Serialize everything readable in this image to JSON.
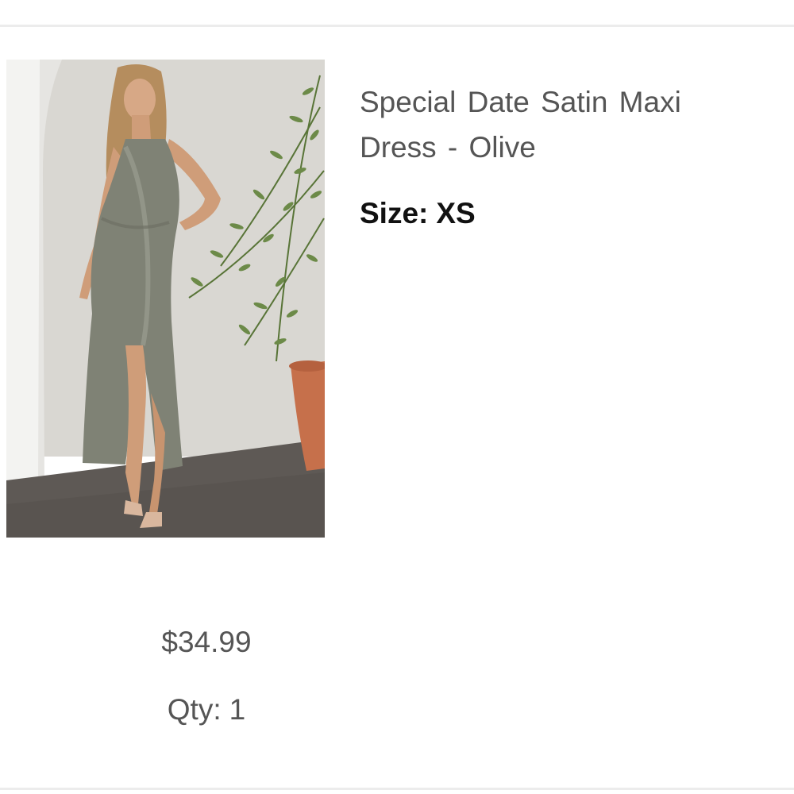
{
  "product": {
    "image_alt": "Model wearing olive satin maxi dress beside potted olive tree",
    "title": "Special Date Satin Maxi Dress - Olive",
    "size_label": "Size:",
    "size_value": "XS",
    "price": "$34.99",
    "qty_label": "Qty:",
    "qty_value": "1"
  },
  "colors": {
    "dress": "#7f8275",
    "wall": "#dcdad5",
    "floor": "#5f5a55",
    "pot": "#c8734f",
    "foliage": "#5d7a3c"
  }
}
